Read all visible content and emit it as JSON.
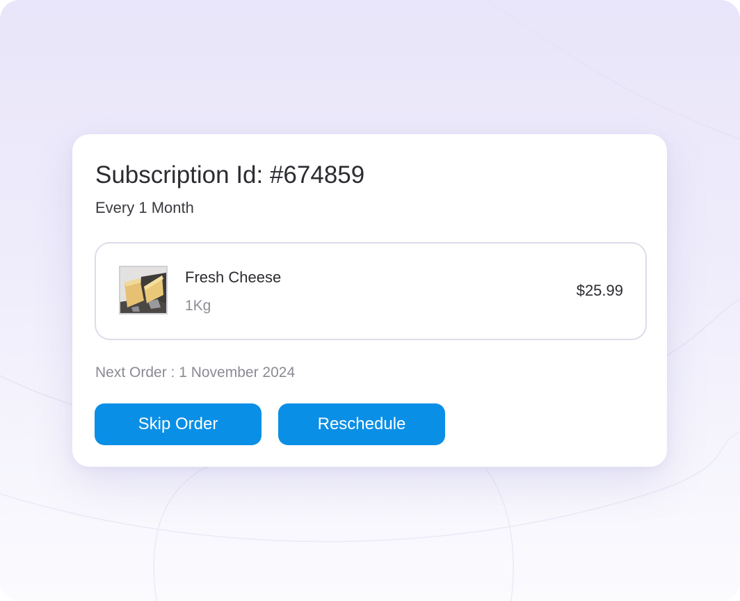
{
  "subscription": {
    "title": "Subscription Id: #674859",
    "frequency": "Every 1 Month"
  },
  "item": {
    "image_icon": "cheese-photo",
    "name": "Fresh Cheese",
    "quantity": "1Kg",
    "price": "$25.99"
  },
  "next_order": "Next Order : 1 November 2024",
  "buttons": {
    "skip_label": "Skip Order",
    "reschedule_label": "Reschedule"
  },
  "colors": {
    "accent": "#0a8fe6",
    "background": "#ece9fb",
    "card": "#ffffff",
    "text_primary": "#2b2b31",
    "text_muted": "#8a8a93"
  }
}
